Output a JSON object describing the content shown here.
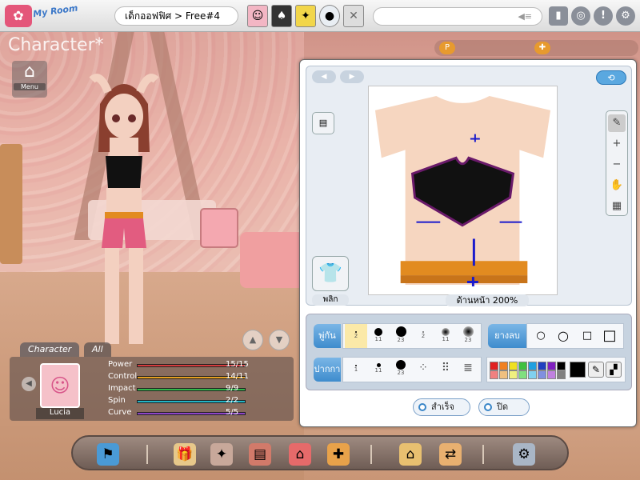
{
  "topbar": {
    "logo_label": "My Room",
    "breadcrumb": "เด็กออฟฟิศ > Free#4",
    "search_glyph": "◀≡",
    "slots": [
      "☺",
      "♠",
      "✦",
      "●",
      "✕"
    ]
  },
  "character_panel": {
    "title": "Character",
    "title_star": "*",
    "menu_label": "Menu",
    "tabs": [
      "Character",
      "All"
    ],
    "avatar_name": "Lucia",
    "stats": [
      {
        "label": "Power",
        "value": "15/15",
        "fraction": 1.0,
        "color": "#d63c3c"
      },
      {
        "label": "Control",
        "value": "14/11",
        "fraction": 1.0,
        "color": "#e6a020"
      },
      {
        "label": "Impact",
        "value": "9/9",
        "fraction": 1.0,
        "color": "#33b54a"
      },
      {
        "label": "Spin",
        "value": "2/2",
        "fraction": 1.0,
        "color": "#22b5c6"
      },
      {
        "label": "Curve",
        "value": "5/5",
        "fraction": 1.0,
        "color": "#8e44c8"
      }
    ]
  },
  "editor": {
    "flip_label": "พลิก",
    "zoom_label": "ด้านหน้า 200%",
    "brush_row_label": "พู่กัน",
    "brush_sizes": [
      "2",
      "11",
      "23",
      "2",
      "11",
      "23"
    ],
    "eraser_label": "ยางลบ",
    "spray_row_label": "ปากกา",
    "spray_sizes": [
      "1",
      "11",
      "23",
      "",
      "",
      ""
    ],
    "ok_label": "สำเร็จ",
    "close_label": "ปิด",
    "palette": [
      "#e02020",
      "#f08020",
      "#f0e020",
      "#40c040",
      "#20a0e0",
      "#2040c0",
      "#8020c0",
      "#000000",
      "#f08080",
      "#f0c080",
      "#f0f080",
      "#80e080",
      "#80d0f0",
      "#8090e0",
      "#c080e0",
      "#808080"
    ]
  },
  "dock": {
    "icons": [
      "flag-icon",
      "gift-icon",
      "wing-icon",
      "book-icon",
      "house-icon",
      "puzzle-icon",
      "home-arrow-icon",
      "home-exchange-icon",
      "settings-plug-icon"
    ]
  }
}
